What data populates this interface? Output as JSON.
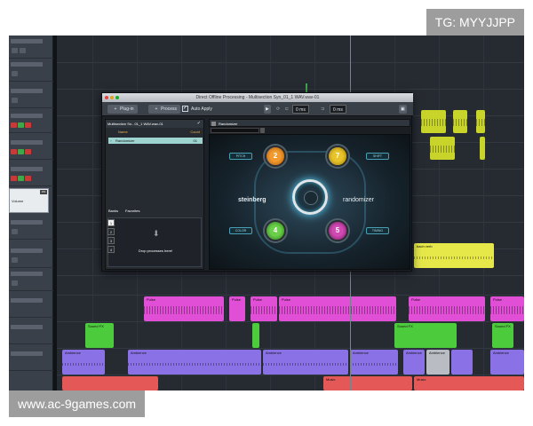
{
  "watermarks": {
    "top": "TG: MYYJJPP",
    "bottom": "www.ac-9games.com"
  },
  "inspector": {
    "label": "Volume",
    "tag": "ON"
  },
  "direct_offline_processing": {
    "title": "Direct Offline Processing - Multisection Syn_01_1 WAV.wav-01",
    "toolbar": {
      "plugin_label": "Plug-in",
      "process_label": "Process",
      "auto_apply_label": "Auto Apply",
      "auto_apply_checked": true,
      "pre_value": "0 ms",
      "post_value": "0 ms"
    },
    "process_list": {
      "header": "Multisection Sn...01_1 WAV.wav-01",
      "col_name": "Name",
      "col_count": "Count",
      "rows": [
        {
          "name": "Randomizer",
          "count": "01"
        }
      ],
      "tabs": [
        "Banks",
        "Favorites"
      ],
      "drop_text": "Drop processes here!",
      "slots": [
        "1",
        "2",
        "3",
        "4"
      ]
    },
    "randomizer": {
      "title": "Randomizer",
      "brand_left": "steinberg",
      "brand_right": "randomizer",
      "labels": [
        "PITCH",
        "SHIFT",
        "COLOR",
        "TIMING"
      ],
      "knobs": [
        "2",
        "7",
        "4",
        "5"
      ]
    }
  },
  "clips": [
    {
      "label": "Pulse",
      "color": "pink"
    },
    {
      "label": "Pulse",
      "color": "pink"
    },
    {
      "label": "Pulse",
      "color": "pink"
    },
    {
      "label": "Pulse",
      "color": "pink"
    },
    {
      "label": "Pulse",
      "color": "pink"
    },
    {
      "label": "Pulse",
      "color": "pink"
    },
    {
      "label": "Sound FX",
      "color": "green"
    },
    {
      "label": "Sound FX",
      "color": "green"
    },
    {
      "label": "Sound FX",
      "color": "green"
    },
    {
      "label": "Ambience",
      "color": "purple"
    },
    {
      "label": "Ambience",
      "color": "purple"
    },
    {
      "label": "Ambience",
      "color": "purple"
    },
    {
      "label": "Ambience",
      "color": "purple"
    },
    {
      "label": "Ambience",
      "color": "purple"
    },
    {
      "label": "Ambience",
      "color": "grey"
    },
    {
      "label": "Ambience",
      "color": "purple"
    },
    {
      "label": "Music",
      "color": "red"
    },
    {
      "label": "Music",
      "color": "red"
    },
    {
      "label": "bach verb",
      "color": "yellow"
    }
  ]
}
